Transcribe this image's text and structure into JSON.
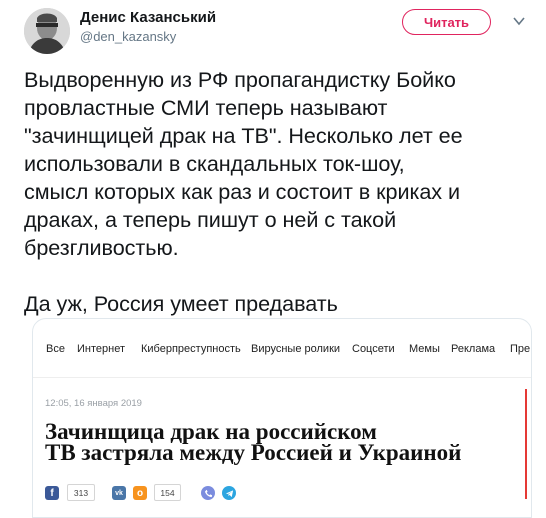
{
  "tweet": {
    "author_name": "Денис Казанський",
    "author_handle": "@den_kazansky",
    "follow_label": "Читать",
    "text_lines": [
      "Выдворенную из РФ пропагандистку Бойко",
      "провластные СМИ теперь называют",
      "\"зачинщицей драк на ТВ\". Несколько лет ее",
      "использовали в скандальных ток-шоу,",
      "смысл которых как раз и состоит в криках и",
      "драках, а теперь пишут о ней с такой",
      "брезгливостью."
    ],
    "text_last": "Да уж, Россия умеет предавать"
  },
  "card": {
    "nav": [
      "Все",
      "Интернет",
      "Киберпреступность",
      "Вирусные ролики",
      "Соцсети",
      "Мемы",
      "Реклама",
      "Пре"
    ],
    "date": "12:05, 16 января 2019",
    "headline_lines": [
      "Зачинщица драк на российском",
      "ТВ застряла между Россией и Украиной"
    ],
    "share": {
      "facebook_count": "313",
      "ok_count": "154"
    }
  },
  "colors": {
    "accent": "#e0245e",
    "text": "#14171a",
    "muted": "#657786",
    "facebook": "#3b5998",
    "vk": "#4a76a8",
    "odnoklassniki": "#f7931e",
    "viber": "#7b8cde",
    "telegram": "#2ca5e0"
  }
}
